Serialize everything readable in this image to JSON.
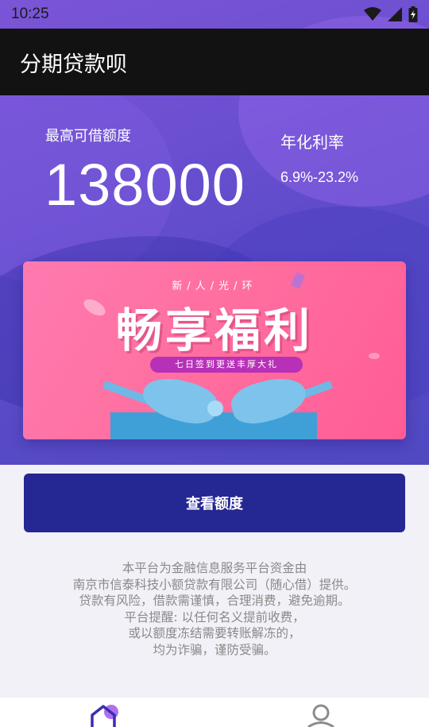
{
  "status_bar": {
    "time": "10:25"
  },
  "app_bar": {
    "title": "分期贷款呗"
  },
  "hero": {
    "max_label": "最高可借额度",
    "max_amount": "138000",
    "rate_label": "年化利率",
    "rate_value": "6.9%-23.2%"
  },
  "banner": {
    "subtitle": "新/人/光/环",
    "title": "畅享福利",
    "pill": "七日签到更送丰厚大礼"
  },
  "cta": {
    "label": "查看额度"
  },
  "disclaimer": {
    "lines": [
      "本平台为金融信息服务平台资金由",
      "南京市信泰科技小额贷款有限公司（随心借）提供。",
      "贷款有风险，借款需谨慎，合理消费，避免逾期。",
      "平台提醒: 以任何名义提前收费，",
      "或以额度冻结需要转账解冻的，",
      "均为诈骗，谨防受骗。"
    ]
  },
  "icons": {
    "home": "home-icon",
    "user": "user-icon",
    "wifi": "wifi-icon",
    "signal": "signal-icon",
    "battery": "battery-icon"
  },
  "colors": {
    "app_bar": "#121212",
    "cta": "#252793",
    "hero": "#6a4fd0",
    "banner": "#ff6fa0",
    "disclaimer": "#8a8a8a"
  }
}
